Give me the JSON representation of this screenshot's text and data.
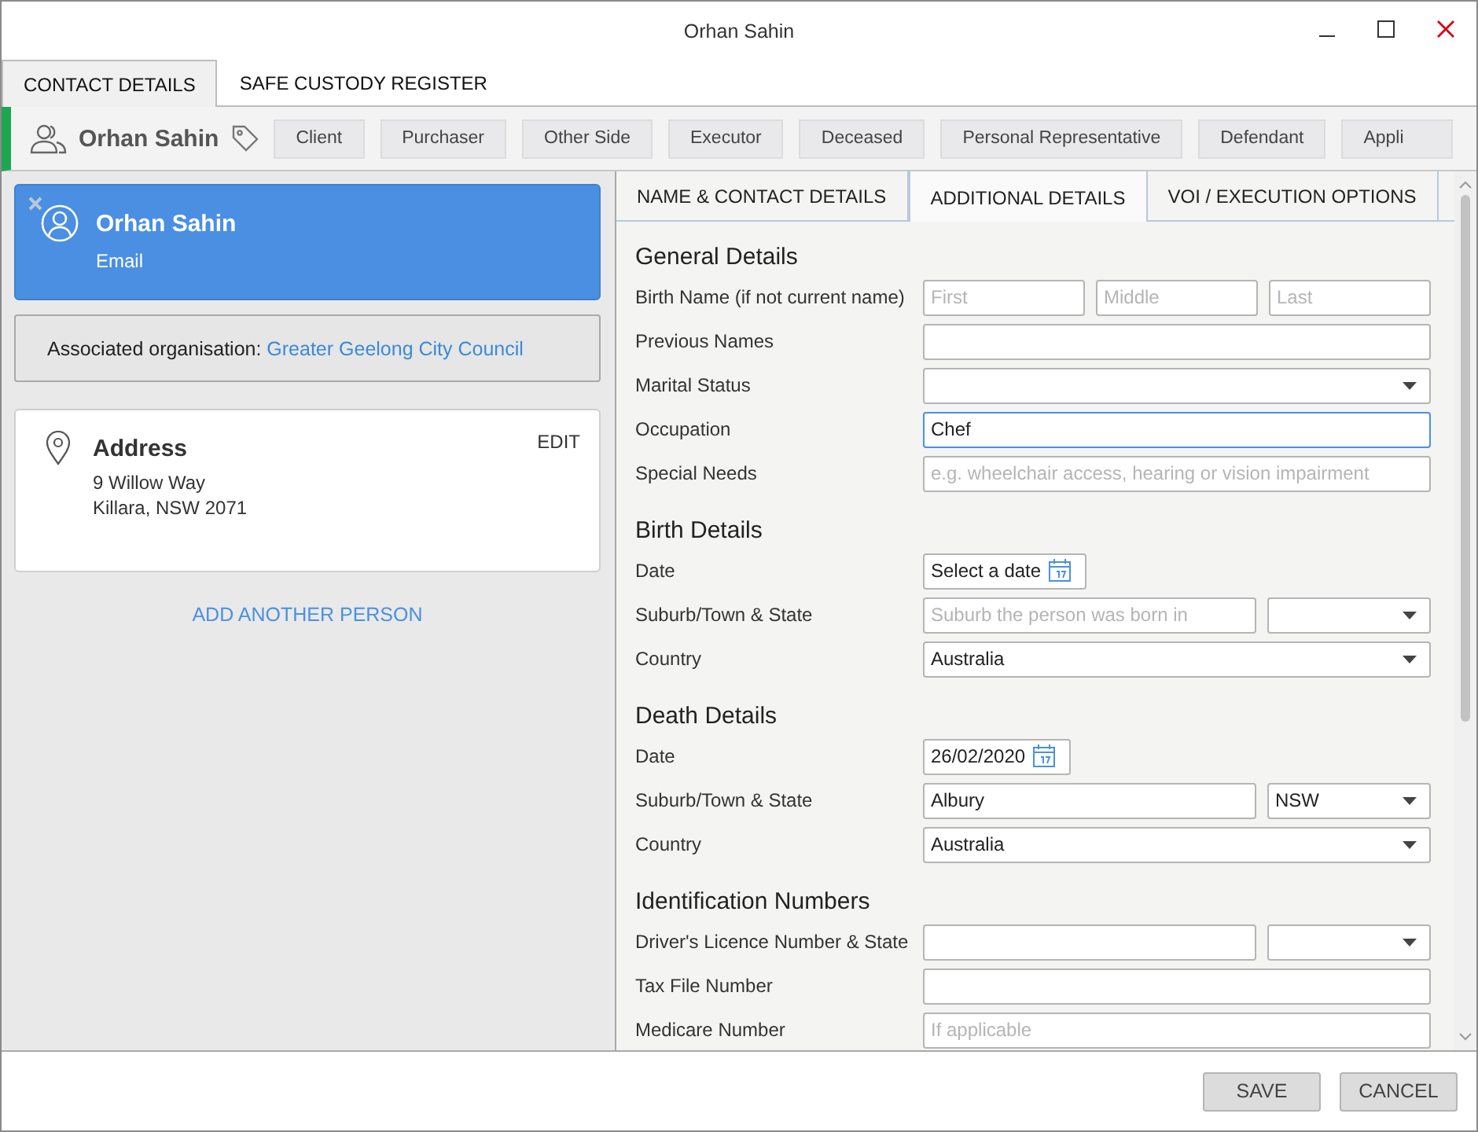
{
  "window": {
    "title": "Orhan Sahin"
  },
  "tabs": [
    {
      "label": "CONTACT DETAILS",
      "selected": true
    },
    {
      "label": "SAFE CUSTODY REGISTER",
      "selected": false
    }
  ],
  "contact_bar": {
    "name": "Orhan Sahin",
    "roles": [
      "Client",
      "Purchaser",
      "Other Side",
      "Executor",
      "Deceased",
      "Personal Representative",
      "Defendant",
      "Appli"
    ]
  },
  "person_card": {
    "name": "Orhan Sahin",
    "detail": "Email",
    "selected": true
  },
  "associated_organisation": {
    "label": "Associated organisation:",
    "link": "Greater Geelong City Council"
  },
  "address_card": {
    "title": "Address",
    "action": "EDIT",
    "lines": [
      "9 Willow Way",
      "Killara, NSW 2071"
    ]
  },
  "add_person_link": "ADD ANOTHER PERSON",
  "detail_tabs": [
    {
      "label": "NAME & CONTACT DETAILS",
      "selected": false
    },
    {
      "label": "ADDITIONAL DETAILS",
      "selected": true
    },
    {
      "label": "VOI / EXECUTION OPTIONS",
      "selected": false
    }
  ],
  "sections": [
    {
      "title": "General Details",
      "rows": [
        {
          "label": "Birth Name (if not current name)",
          "fields": [
            {
              "kind": "text",
              "placeholder": "First",
              "focused": false
            },
            {
              "kind": "text",
              "placeholder": "Middle",
              "focused": false
            },
            {
              "kind": "text",
              "placeholder": "Last",
              "focused": false
            }
          ]
        },
        {
          "label": "Previous Names",
          "fields": [
            {
              "kind": "text",
              "focused": false
            }
          ]
        },
        {
          "label": "Marital Status",
          "fields": [
            {
              "kind": "select",
              "focused": false
            }
          ]
        },
        {
          "label": "Occupation",
          "fields": [
            {
              "kind": "text",
              "value": "Chef",
              "focused": true
            }
          ]
        },
        {
          "label": "Special Needs",
          "fields": [
            {
              "kind": "text",
              "placeholder": "e.g. wheelchair access, hearing or vision impairment",
              "focused": false
            }
          ]
        }
      ]
    },
    {
      "title": "Birth Details",
      "rows": [
        {
          "label": "Date",
          "fields": [
            {
              "kind": "date",
              "value": "Select a date",
              "focused": false
            }
          ]
        },
        {
          "label": "Suburb/Town & State",
          "fields": [
            {
              "kind": "text",
              "placeholder": "Suburb the person was born in",
              "focused": false
            },
            {
              "kind": "state-select",
              "focused": false
            }
          ]
        },
        {
          "label": "Country",
          "fields": [
            {
              "kind": "select",
              "value": "Australia",
              "focused": false
            }
          ]
        }
      ]
    },
    {
      "title": "Death Details",
      "rows": [
        {
          "label": "Date",
          "fields": [
            {
              "kind": "date",
              "value": "26/02/2020",
              "focused": false
            }
          ]
        },
        {
          "label": "Suburb/Town & State",
          "fields": [
            {
              "kind": "text",
              "value": "Albury",
              "focused": false
            },
            {
              "kind": "state-select",
              "value": "NSW",
              "focused": false
            }
          ]
        },
        {
          "label": "Country",
          "fields": [
            {
              "kind": "select",
              "value": "Australia",
              "focused": false
            }
          ]
        }
      ]
    },
    {
      "title": "Identification Numbers",
      "rows": [
        {
          "label": "Driver's Licence Number & State",
          "fields": [
            {
              "kind": "text",
              "focused": false
            },
            {
              "kind": "state-select",
              "focused": false
            }
          ]
        },
        {
          "label": "Tax File Number",
          "fields": [
            {
              "kind": "text",
              "focused": false
            }
          ]
        },
        {
          "label": "Medicare Number",
          "fields": [
            {
              "kind": "text",
              "placeholder": "If applicable",
              "focused": false
            }
          ]
        }
      ]
    }
  ],
  "buttons": [
    "SAVE",
    "CANCEL"
  ]
}
